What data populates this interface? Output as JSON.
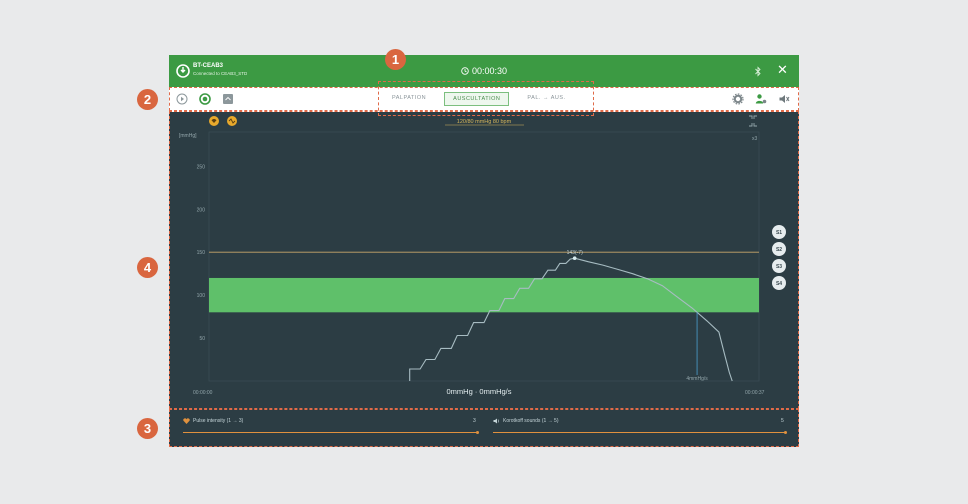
{
  "app": {
    "device_name": "BT-CEAB3",
    "connection_status": "Connected to CEAB3_STD",
    "timer": "00:00:30"
  },
  "toolbar": {
    "tabs": [
      {
        "label": "PALPATION",
        "active": false
      },
      {
        "label": "AUSCULTATION",
        "active": true
      },
      {
        "label": "PAL. → AUS.",
        "active": false
      }
    ]
  },
  "chart_data": {
    "type": "line",
    "title": "120/80 mmHg 80 bpm",
    "ylabel": "[mmHg]",
    "xlabel": "0mmHg · 0mmHg/s",
    "x_range_labels": [
      "00:00:00",
      "00:00:37"
    ],
    "y_ticks": [
      50,
      100,
      150,
      200,
      250
    ],
    "ylim": [
      0,
      290
    ],
    "xlim": [
      0,
      37
    ],
    "zoom_label": "x3",
    "cuff_target_line": 150,
    "target_band": [
      80,
      120
    ],
    "peak_label": "143(-7)",
    "marker_label": "4mmHg/s",
    "sound_buttons": [
      "S1",
      "S2",
      "S3",
      "S4"
    ],
    "series": [
      {
        "values": [
          [
            13.5,
            0
          ],
          [
            13.5,
            14
          ],
          [
            14.2,
            14
          ],
          [
            14.6,
            25
          ],
          [
            15.2,
            25
          ],
          [
            15.6,
            38
          ],
          [
            16.3,
            38
          ],
          [
            16.7,
            53
          ],
          [
            17.4,
            53
          ],
          [
            17.8,
            68
          ],
          [
            18.5,
            68
          ],
          [
            18.9,
            82
          ],
          [
            19.5,
            82
          ],
          [
            19.9,
            96
          ],
          [
            20.5,
            96
          ],
          [
            20.9,
            108
          ],
          [
            21.5,
            108
          ],
          [
            21.9,
            119
          ],
          [
            22.4,
            119
          ],
          [
            22.8,
            129
          ],
          [
            23.3,
            129
          ],
          [
            23.6,
            137
          ],
          [
            24.0,
            137
          ],
          [
            24.3,
            142
          ],
          [
            24.6,
            143
          ],
          [
            25.5,
            139
          ],
          [
            26.5,
            135
          ],
          [
            27.5,
            130
          ],
          [
            28.5,
            125
          ],
          [
            29.5,
            119
          ],
          [
            30.5,
            111
          ],
          [
            31.5,
            98
          ],
          [
            32.5,
            85
          ],
          [
            33.5,
            70
          ],
          [
            34.3,
            57
          ],
          [
            34.7,
            30
          ],
          [
            35.0,
            10
          ],
          [
            35.2,
            0
          ]
        ],
        "color": "#a7bcc2"
      }
    ]
  },
  "controls": {
    "pulse_label": "Pulse intensity (1 → 3)",
    "pulse_value": "3",
    "pulse_level": 1.0,
    "korotkoff_label": "Korotkoff sounds (1 → 5)",
    "korotkoff_value": "5",
    "korotkoff_level": 1.0
  },
  "annotations": [
    "1",
    "2",
    "3",
    "4"
  ],
  "colors": {
    "titlebar": "#3c9a43",
    "background": "#2c3d44",
    "target_band": "#5fc06a",
    "cuff_line": "#c9a76a",
    "accent": "#e0913e",
    "annotation": "#d9663f"
  }
}
